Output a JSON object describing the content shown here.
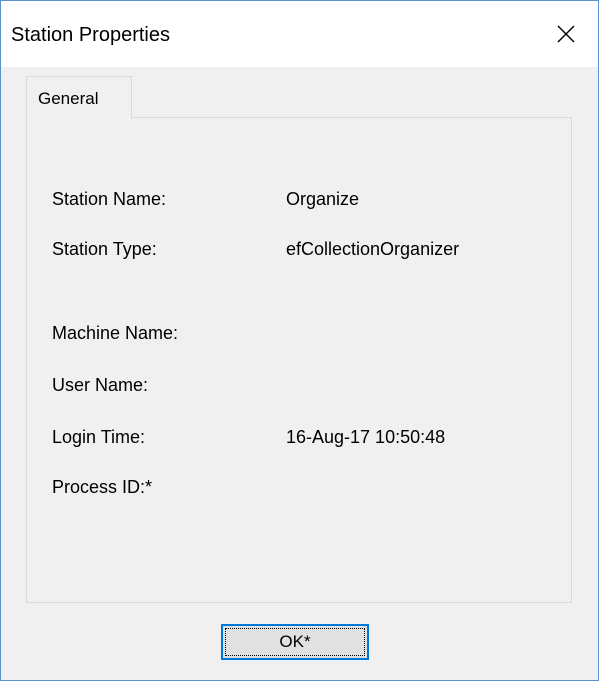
{
  "window": {
    "title": "Station Properties"
  },
  "tabs": [
    {
      "label": "General",
      "selected": true
    }
  ],
  "properties": [
    {
      "label": "Station Name:",
      "value": "Organize"
    },
    {
      "label": "Station Type:",
      "value": "efCollectionOrganizer"
    },
    {
      "label": "Machine Name:",
      "value": ""
    },
    {
      "label": "User Name:",
      "value": ""
    },
    {
      "label": "Login Time:",
      "value": "16-Aug-17 10:50:48"
    },
    {
      "label": "Process ID:*",
      "value": ""
    }
  ],
  "buttons": {
    "ok_label": "OK*"
  },
  "icons": {
    "close": "close-icon"
  },
  "colors": {
    "titlebar_bg": "#ffffff",
    "window_bg": "#f0f0f0",
    "window_border": "#5b8fce",
    "button_focus_border": "#0078d7"
  }
}
